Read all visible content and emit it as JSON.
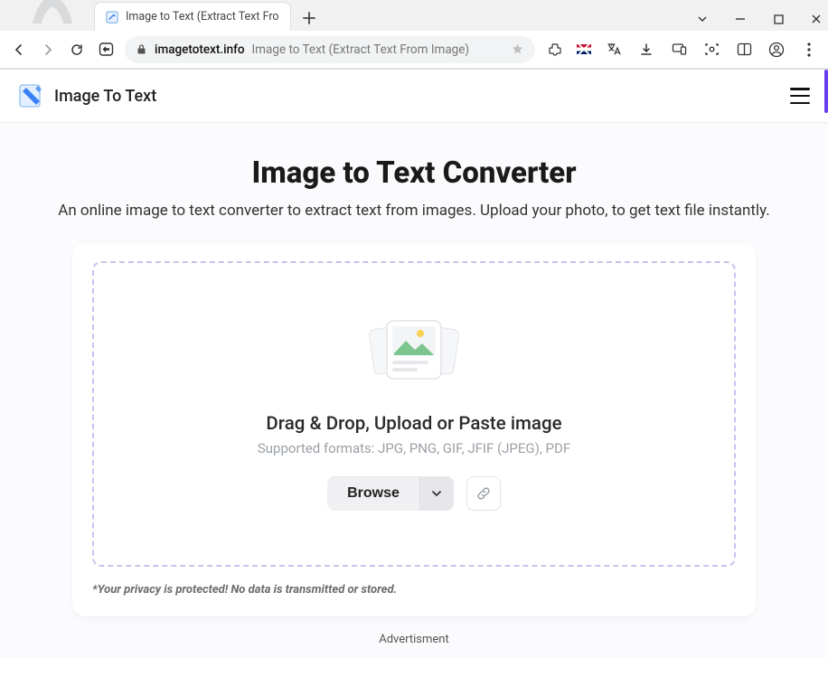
{
  "window": {
    "tab_title": "Image to Text (Extract Text From",
    "address_domain": "imagetotext.info",
    "address_title": "Image to Text (Extract Text From Image)"
  },
  "site": {
    "brand": "Image To Text"
  },
  "hero": {
    "heading": "Image to Text Converter",
    "sub": "An online image to text converter to extract text from images. Upload your photo, to get text file instantly."
  },
  "drop": {
    "heading": "Drag & Drop, Upload or Paste image",
    "formats": "Supported formats: JPG, PNG, GIF, JFIF (JPEG), PDF",
    "browse_label": "Browse"
  },
  "privacy": "*Your privacy is protected! No data is transmitted or stored.",
  "ad_label": "Advertisment"
}
